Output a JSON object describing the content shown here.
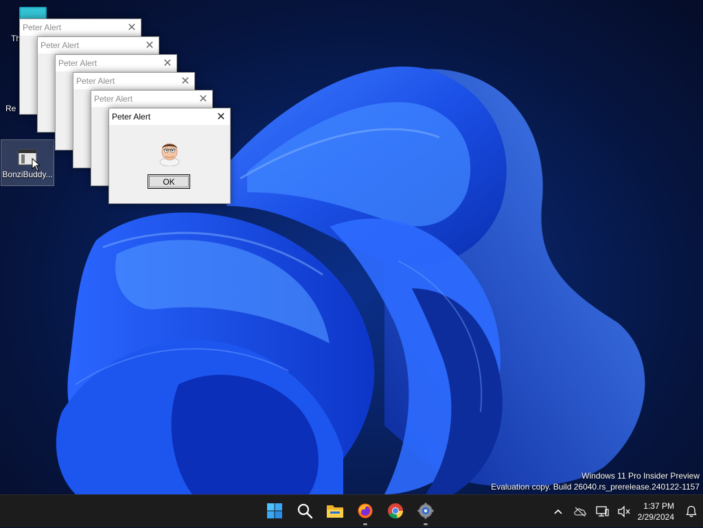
{
  "desktop": {
    "icons": [
      {
        "label": "Th",
        "name": "this-pc-partial"
      },
      {
        "label": "Re",
        "name": "recycle-bin-partial"
      },
      {
        "label": "BonziBuddy...",
        "name": "bonzibuddy"
      }
    ]
  },
  "dialogs": [
    {
      "title": "Peter Alert"
    },
    {
      "title": "Peter Alert"
    },
    {
      "title": "Peter Alert"
    },
    {
      "title": "Peter Alert"
    },
    {
      "title": "Peter Alert"
    },
    {
      "title": "Peter Alert",
      "ok_label": "OK"
    }
  ],
  "watermark": {
    "line1": "Windows 11 Pro Insider Preview",
    "line2": "Evaluation copy. Build 26040.rs_prerelease.240122-1157"
  },
  "taskbar": {
    "pinned": [
      "windows-start-icon",
      "search-icon",
      "file-explorer-icon",
      "firefox-icon",
      "chrome-icon",
      "settings-icon"
    ],
    "tray_icons": [
      "chevron-up-icon",
      "onedrive-offline-icon",
      "network-icon",
      "volume-muted-icon"
    ],
    "time": "1:37 PM",
    "date": "2/29/2024",
    "notification_icon": "bell-icon"
  },
  "colors": {
    "accent": "#1f5bff",
    "taskbar": "#1c1c1c"
  }
}
